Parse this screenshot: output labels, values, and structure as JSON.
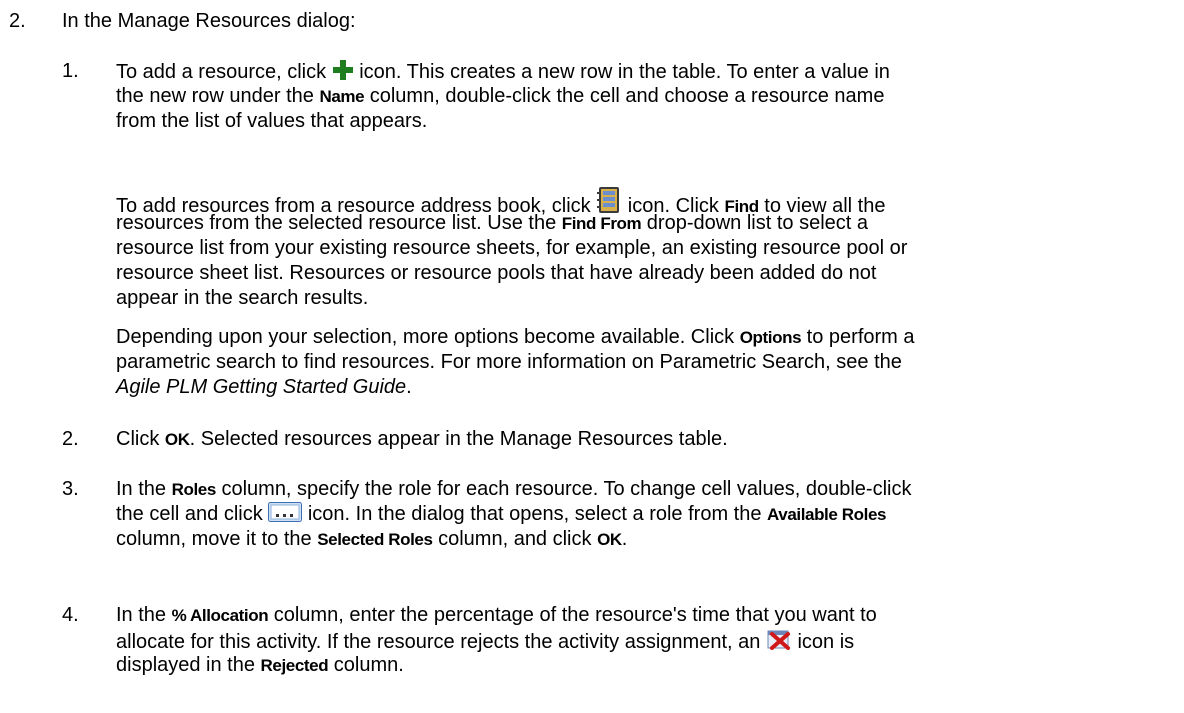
{
  "step2": {
    "number": "2.",
    "text": "In the Manage Resources dialog:"
  },
  "substeps": {
    "s1": {
      "number": "1.",
      "p1": {
        "l1_a": "To add a resource, click ",
        "l1_b": " icon. This creates a new row in the table. To enter a value in",
        "l2_a": "the new row under the ",
        "l2_name": "Name",
        "l2_b": " column, double-click the cell and choose a resource name",
        "l3": "from the list of values that appears."
      },
      "p2": {
        "l1_a": "To add resources from a resource address book, click ",
        "l1_b": " icon. Click ",
        "l1_find": "Find",
        "l1_c": " to view all the",
        "l2_a": "resources from the selected resource list. Use the ",
        "l2_findfrom": "Find From",
        "l2_b": " drop-down list to select a",
        "l3": "resource list from your existing resource sheets, for example, an existing resource pool or",
        "l4": "resource sheet list. Resources or resource pools that have already been added do not",
        "l5": "appear in the search results."
      },
      "p3": {
        "l1_a": "Depending upon your selection, more options become available. Click ",
        "l1_options": "Options",
        "l1_b": " to perform a",
        "l2": "parametric search to find resources. For more information on Parametric Search, see the",
        "l3_guide": "Agile PLM Getting Started Guide",
        "l3_end": "."
      }
    },
    "s2": {
      "number": "2.",
      "a": "Click ",
      "ok": "OK",
      "b": ". Selected resources appear in the Manage Resources table."
    },
    "s3": {
      "number": "3.",
      "l1_a": "In the ",
      "l1_roles": "Roles",
      "l1_b": " column, specify the role for each resource. To change cell values, double-click",
      "l2_a": "the cell and click ",
      "l2_b": " icon. In the dialog that opens, select a role from the ",
      "l2_available": "Available Roles",
      "l3_a": "column, move it to the ",
      "l3_selected": "Selected Roles",
      "l3_b": " column, and click ",
      "l3_ok": "OK",
      "l3_end": "."
    },
    "s4": {
      "number": "4.",
      "l1_a": "In the ",
      "l1_alloc": "% Allocation",
      "l1_b": " column, enter the percentage of the resource's time that you want to",
      "l2_a": "allocate for this activity. If the resource rejects the activity assignment, an ",
      "l2_b": " icon is",
      "l3_a": "displayed in the ",
      "l3_rejected": "Rejected",
      "l3_b": " column."
    }
  },
  "icons": {
    "add": "add-plus-icon",
    "address_book": "address-book-icon",
    "ellipsis": "ellipsis-picker-icon",
    "rejected": "rejected-x-icon"
  },
  "colors": {
    "add_icon": "#1e7d1e",
    "rejected_icon": "#d01818"
  }
}
